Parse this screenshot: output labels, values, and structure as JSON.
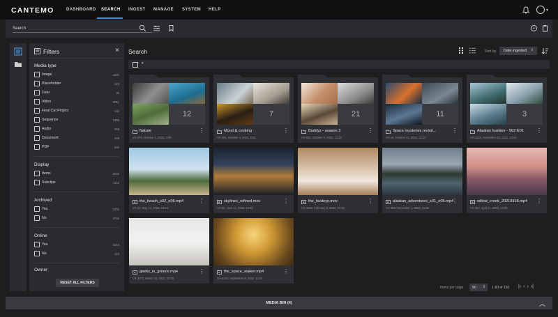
{
  "app": {
    "logo": "CANTEMO"
  },
  "nav": [
    {
      "label": "DASHBOARD"
    },
    {
      "label": "SEARCH"
    },
    {
      "label": "INGEST"
    },
    {
      "label": "MANAGE"
    },
    {
      "label": "SYSTEM"
    },
    {
      "label": "HELP"
    }
  ],
  "search": {
    "label": "Search"
  },
  "filters": {
    "title": "Filters",
    "sections": {
      "media_type": "Media type",
      "display": "Display",
      "archived": "Archived",
      "online": "Online",
      "owner": "Owner"
    },
    "media_type": [
      {
        "label": "Image",
        "count": "1101"
      },
      {
        "label": "Placeholder",
        "count": "123"
      },
      {
        "label": "Data",
        "count": "36"
      },
      {
        "label": "Video",
        "count": "2011"
      },
      {
        "label": "Final Cut Project",
        "count": "132"
      },
      {
        "label": "Sequence",
        "count": "1266"
      },
      {
        "label": "Audio",
        "count": "993"
      },
      {
        "label": "Document",
        "count": "245"
      },
      {
        "label": "PDF",
        "count": "632"
      }
    ],
    "display": [
      {
        "label": "Items",
        "count": "3232"
      },
      {
        "label": "Subclips",
        "count": "1142"
      }
    ],
    "archived": [
      {
        "label": "Yes",
        "count": "1002"
      },
      {
        "label": "No",
        "count": "4732"
      }
    ],
    "online": [
      {
        "label": "Yes",
        "count": "3244"
      },
      {
        "label": "No",
        "count": "123"
      }
    ],
    "reset": "RESET ALL FILTERS"
  },
  "main": {
    "title": "Search",
    "sort_label": "Sort by",
    "sort_value": "Date ingested",
    "items_per_page_label": "Items per page",
    "items_per_page": "50",
    "range": "1-50 of 150"
  },
  "collections": [
    {
      "title": "Nature",
      "sub": "VX-373, October 1, 2022, 3:30",
      "count": "12"
    },
    {
      "title": "Mood & cooking",
      "sub": "VX-101, October 4, 2022, 9:21",
      "count": "7"
    },
    {
      "title": "Buddyz - season 3",
      "sub": "VX-832, October 9, 2022, 21:23",
      "count": "21"
    },
    {
      "title": "Space mysteries revisit...",
      "sub": "VX-44, October 11, 2022, 13:22",
      "count": "11"
    },
    {
      "title": "Alaskan huskies - S02 E01",
      "sub": "VX-2323, November 13, 2022, 13:41",
      "count": "3"
    }
  ],
  "items": [
    {
      "title": "the_beach_s02_e06.mp4",
      "sub": "VX-32, May 14, 2022, 14:15"
    },
    {
      "title": "skylines_refined.mov",
      "sub": "VX-86, June 11, 2022, 12:52"
    },
    {
      "title": "the_huxleys.mov",
      "sub": "VX-3234, February 5, 2022, 01:52"
    },
    {
      "title": "alaskan_adventures_s01_e05.mp4",
      "sub": "VX-303, December 1, 2022, 11:32"
    },
    {
      "title": "willow_creek_20210918.mp4",
      "sub": "VX-452, April 21, 2022, 14:56"
    },
    {
      "title": "geeks_in_greece.mp4",
      "sub": "VX-2472, March 15, 2022, 10:30"
    },
    {
      "title": "the_space_walker.mp4",
      "sub": "VX-3134, September 9, 2022, 12:43"
    }
  ],
  "media_bin": {
    "label": "MEDIA BIN (4)"
  }
}
